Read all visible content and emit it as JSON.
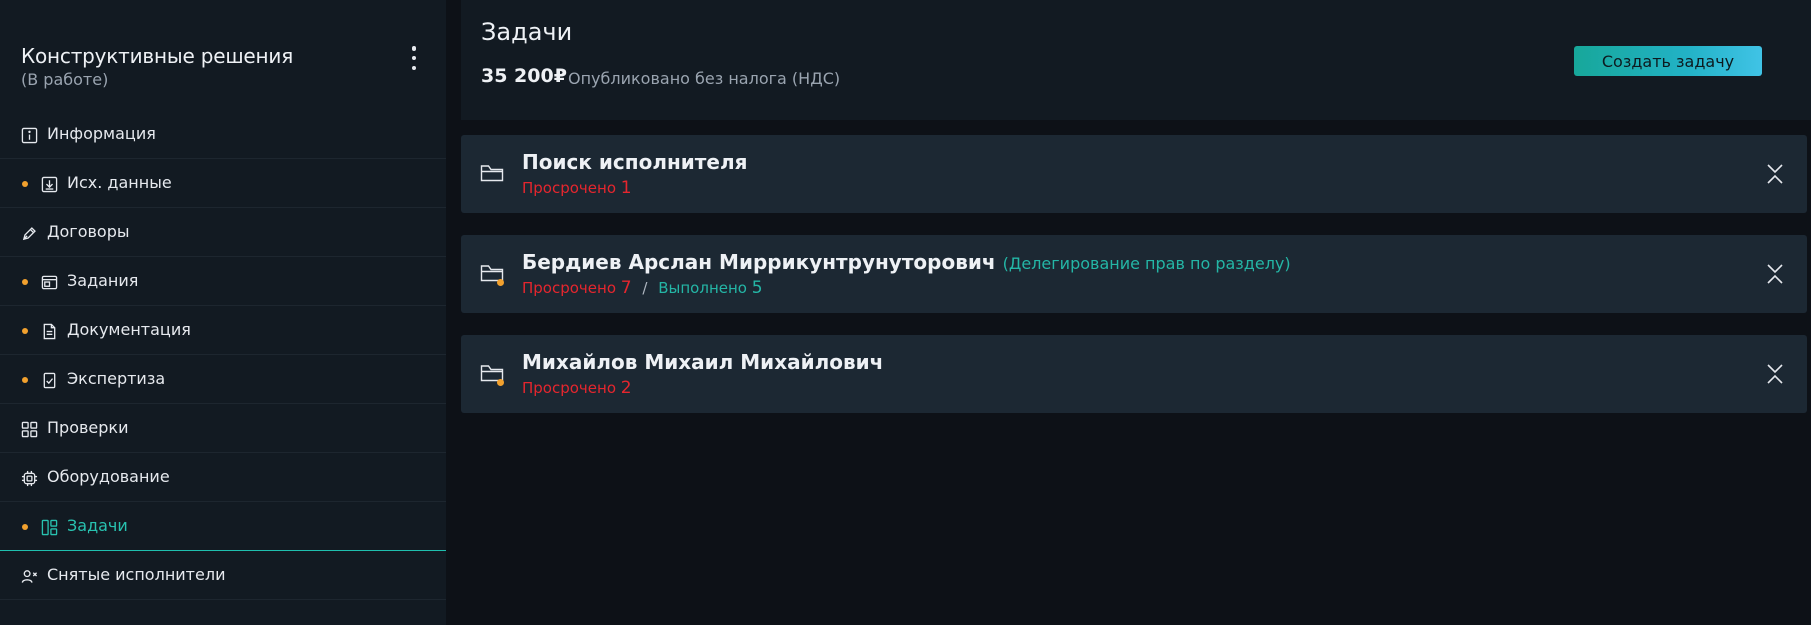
{
  "sidebar": {
    "project_title": "Конструктивные решения",
    "project_status": "(В работе)",
    "items": [
      {
        "label": "Информация",
        "icon": "info-icon",
        "dot": false,
        "active": false
      },
      {
        "label": "Исх. данные",
        "icon": "download-icon",
        "dot": true,
        "active": false
      },
      {
        "label": "Договоры",
        "icon": "pen-icon",
        "dot": false,
        "active": false
      },
      {
        "label": "Задания",
        "icon": "window-icon",
        "dot": true,
        "active": false
      },
      {
        "label": "Документация",
        "icon": "document-icon",
        "dot": true,
        "active": false
      },
      {
        "label": "Экспертиза",
        "icon": "checked-document-icon",
        "dot": true,
        "active": false
      },
      {
        "label": "Проверки",
        "icon": "grid-icon",
        "dot": false,
        "active": false
      },
      {
        "label": "Оборудование",
        "icon": "chip-icon",
        "dot": false,
        "active": false
      },
      {
        "label": "Задачи",
        "icon": "board-icon",
        "dot": true,
        "active": true
      },
      {
        "label": "Снятые исполнители",
        "icon": "user-remove-icon",
        "dot": false,
        "active": false
      }
    ]
  },
  "header": {
    "title": "Задачи",
    "amount": "35 200₽",
    "tax_note": "Опубликовано без налога (НДС)",
    "create_button": "Создать задачу"
  },
  "groups": [
    {
      "title": "Поиск исполнителя",
      "overdue_label": "Просрочено",
      "overdue_count": "1"
    },
    {
      "title": "Бердиев Арслан Миррикунтрунуторович",
      "delegation": "(Делегирование прав по разделу)",
      "overdue_label": "Просрочено",
      "overdue_count": "7",
      "separator": "/",
      "done_label": "Выполнено",
      "done_count": "5"
    },
    {
      "title": "Михайлов Михаил Михайлович",
      "overdue_label": "Просрочено",
      "overdue_count": "2"
    }
  ],
  "colors": {
    "accent": "#24b6a6",
    "overdue": "#e5262e",
    "notification_dot": "#f2a12e",
    "sidebar_bg": "#121a22",
    "card_bg": "#1c2833"
  }
}
